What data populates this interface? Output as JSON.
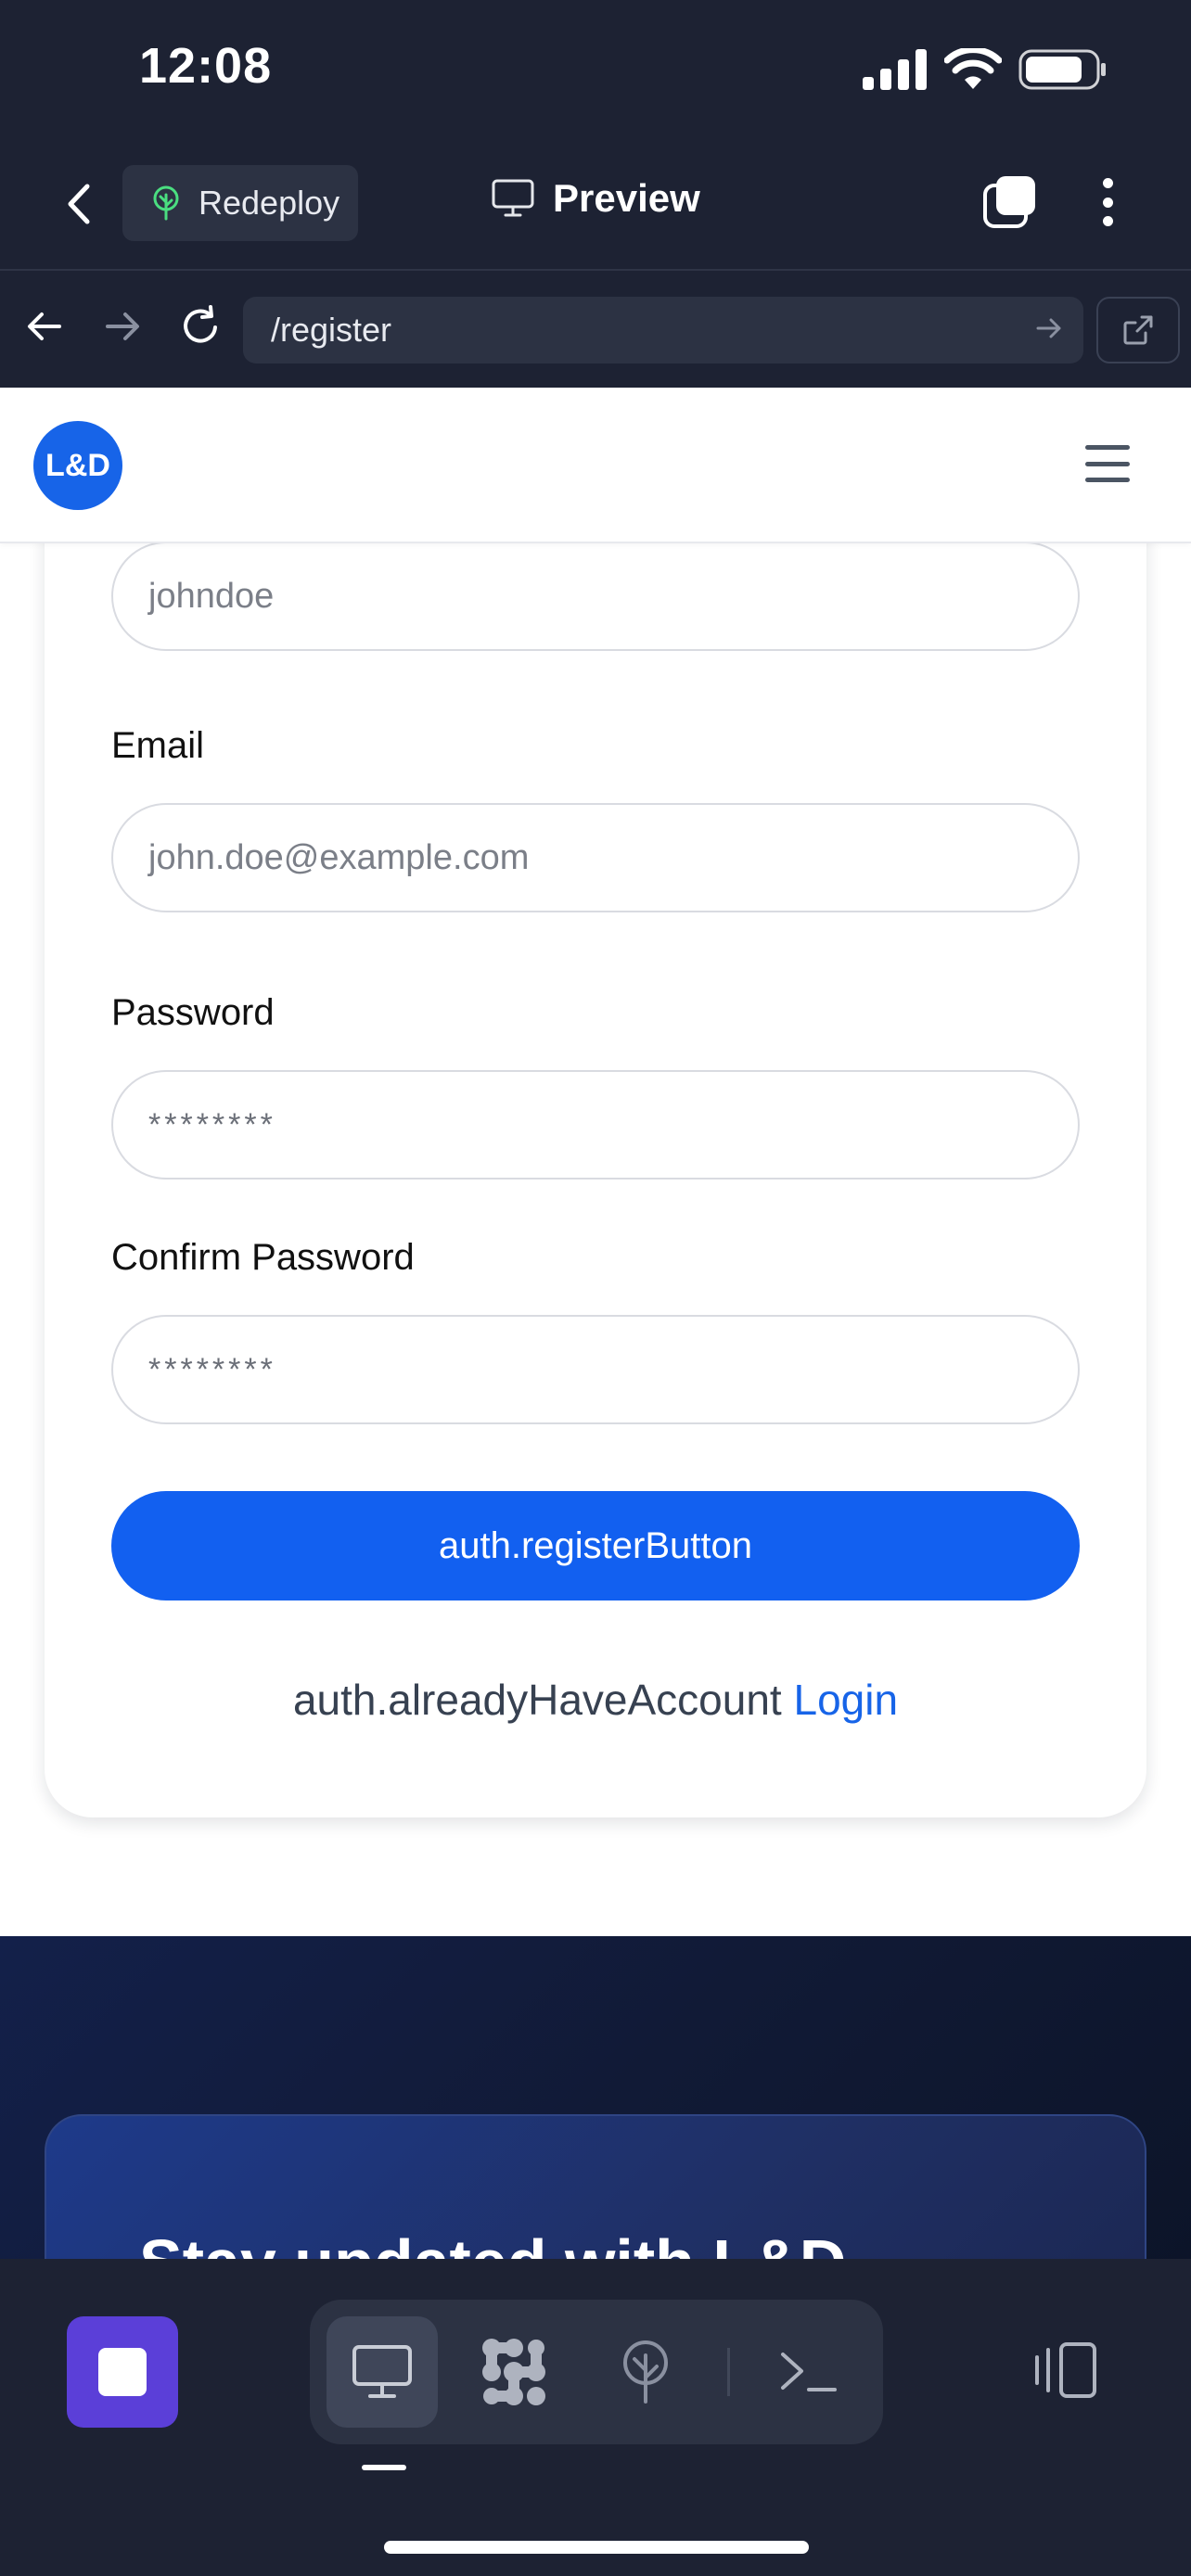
{
  "status_bar": {
    "time": "12:08"
  },
  "app_bar": {
    "redeploy_label": "Redeploy",
    "title": "Preview"
  },
  "browser": {
    "url": "/register"
  },
  "site": {
    "logo_text": "L&D"
  },
  "form": {
    "username_placeholder": "johndoe",
    "email_label": "Email",
    "email_placeholder": "john.doe@example.com",
    "password_label": "Password",
    "password_placeholder": "********",
    "confirm_password_label": "Confirm Password",
    "confirm_password_placeholder": "********",
    "register_button": "auth.registerButton",
    "already_have_account": "auth.alreadyHaveAccount",
    "login_link": "Login"
  },
  "footer": {
    "newsletter_title": "Stay updated with L&D"
  },
  "colors": {
    "accent": "#1260f0",
    "chrome_bg": "#1d2233",
    "stop_button": "#5b3fd8"
  },
  "icons": {
    "bottom_tools": [
      "monitor-icon",
      "grid-blob-icon",
      "tree-icon",
      "terminal-icon"
    ]
  }
}
